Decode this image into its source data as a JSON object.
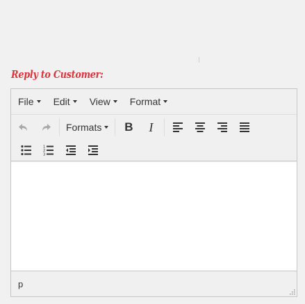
{
  "heading": "Reply to Customer:",
  "menubar": {
    "items": [
      {
        "label": "File"
      },
      {
        "label": "Edit"
      },
      {
        "label": "View"
      },
      {
        "label": "Format"
      }
    ]
  },
  "toolbar": {
    "formats_label": "Formats",
    "bold_glyph": "B",
    "italic_glyph": "I"
  },
  "editor": {
    "content": ""
  },
  "statusbar": {
    "path": "p"
  },
  "colors": {
    "heading": "#d9343c",
    "icon": "#333333",
    "icon_disabled": "#a8a8a8"
  },
  "icons": [
    "undo-icon",
    "redo-icon",
    "align-left-icon",
    "align-center-icon",
    "align-right-icon",
    "align-justify-icon",
    "bullet-list-icon",
    "numbered-list-icon",
    "outdent-icon",
    "indent-icon",
    "resize-handle-icon"
  ]
}
